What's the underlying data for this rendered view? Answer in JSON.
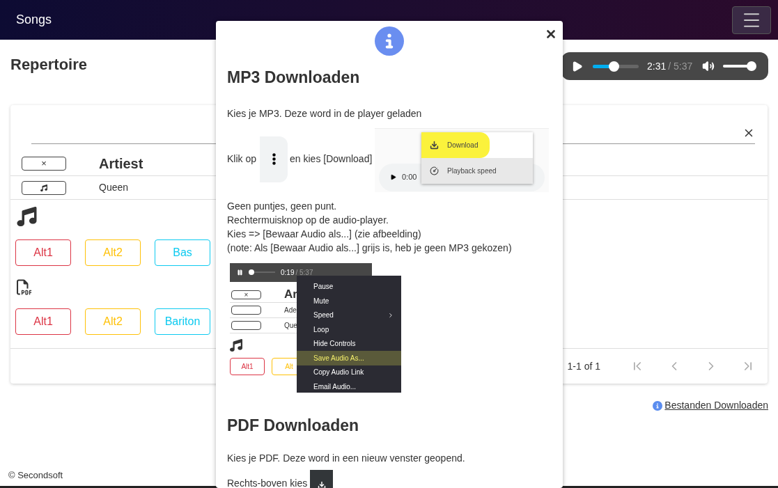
{
  "navbar": {
    "title": "Songs"
  },
  "page": {
    "title": "Repertoire"
  },
  "player": {
    "playing": false,
    "progress": {
      "level": 0.45
    },
    "current_time": "2:31",
    "duration": "/ 5:37",
    "volume": {
      "level": 0.88
    }
  },
  "song_table": {
    "clear_button": "×",
    "column": "Artiest",
    "rows": [
      {
        "artist": "Queen"
      }
    ]
  },
  "mp3_buttons": [
    {
      "label": "Alt1",
      "color": "#dc3545"
    },
    {
      "label": "Alt2",
      "color": "#ffc107"
    },
    {
      "label": "Bas",
      "color": "#0dcaf0"
    }
  ],
  "pdf_buttons": [
    {
      "label": "Alt1",
      "color": "#dc3545"
    },
    {
      "label": "Alt2",
      "color": "#ffc107"
    },
    {
      "label": "Bariton",
      "color": "#0dcaf0"
    }
  ],
  "pagination": {
    "range": "1-1 of 1"
  },
  "help_link": "Bestanden Downloaden",
  "footer": "© Secondsoft",
  "modal": {
    "mp3": {
      "heading": "MP3 Downloaden",
      "step1": "Kies je MP3. Deze word in de player geladen",
      "step2_before": "Klik op",
      "step2_after": "en kies [Download]",
      "notes": [
        "Geen puntjes, geen punt.",
        "Rechtermuisknop op de audio-player.",
        "Kies => [Bewaar Audio als...] (zie afbeelding)",
        "(note: Als [Bewaar Audio als...] grijs is, heb je geen MP3 gekozen)"
      ]
    },
    "screenshot_1": {
      "time": "0:00",
      "menu": [
        {
          "label": "Download",
          "kind": "download",
          "highlighted": true
        },
        {
          "label": "Playback speed",
          "kind": "speed",
          "highlighted": false
        }
      ]
    },
    "screenshot_2": {
      "current_time": "0:19",
      "duration": "/ 5:37",
      "clear_button": "×",
      "column": "Ar",
      "rows": [
        "Ade",
        "Que"
      ],
      "buttons": [
        {
          "label": "Alt1",
          "color": "#dc3545"
        },
        {
          "label": "Alt",
          "color": "#ffc107"
        }
      ],
      "menu": [
        {
          "label": "Pause",
          "highlighted": false,
          "submenu": false
        },
        {
          "label": "Mute",
          "highlighted": false,
          "submenu": false
        },
        {
          "label": "Speed",
          "highlighted": false,
          "submenu": true
        },
        {
          "label": "Loop",
          "highlighted": false,
          "submenu": false
        },
        {
          "label": "Hide Controls",
          "highlighted": false,
          "submenu": false
        },
        {
          "label": "Save Audio As...",
          "highlighted": true,
          "submenu": false
        },
        {
          "label": "Copy Audio Link",
          "highlighted": false,
          "submenu": false
        },
        {
          "label": "Email Audio...",
          "highlighted": false,
          "submenu": false
        }
      ]
    },
    "pdf": {
      "heading": "PDF Downloaden",
      "step1": "Kies je PDF. Deze word in een nieuw venster geopend.",
      "step2": "Rechts-boven kies"
    }
  }
}
